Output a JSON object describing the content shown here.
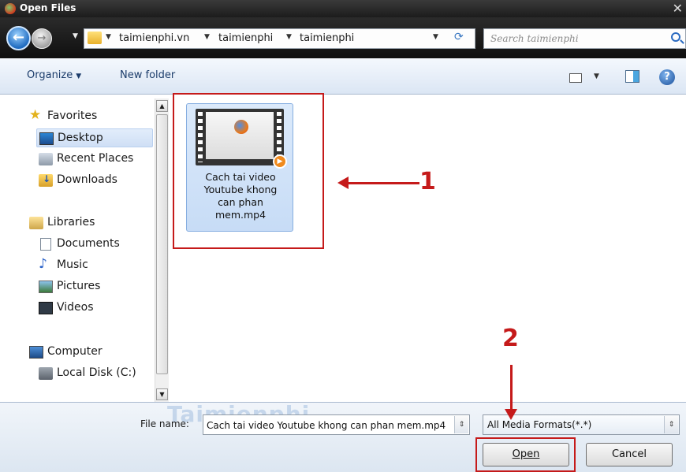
{
  "window": {
    "title": "Open Files"
  },
  "address": {
    "crumbs": [
      "taimienphi.vn",
      "taimienphi",
      "taimienphi"
    ],
    "search_placeholder": "Search taimienphi"
  },
  "toolbar": {
    "organize": "Organize",
    "new_folder": "New folder"
  },
  "sidebar": {
    "favorites": "Favorites",
    "desktop": "Desktop",
    "recent_places": "Recent Places",
    "downloads": "Downloads",
    "libraries": "Libraries",
    "documents": "Documents",
    "music": "Music",
    "pictures": "Pictures",
    "videos": "Videos",
    "computer": "Computer",
    "local_disk": "Local Disk (C:)"
  },
  "files": [
    {
      "name_lines": [
        "Cach tai video",
        "Youtube khong",
        "can phan",
        "mem.mp4"
      ]
    }
  ],
  "footer": {
    "file_name_label": "File name:",
    "file_name_value": "Cach tai video Youtube khong can phan mem.mp4",
    "file_type": "All Media Formats(*.*)",
    "open": "Open",
    "cancel": "Cancel"
  },
  "annotations": {
    "marker_1": "1",
    "marker_2": "2",
    "watermark": "Taimienphi"
  },
  "colors": {
    "annotation_red": "#c51a1a",
    "selection_blue": "#c7dcf6"
  }
}
